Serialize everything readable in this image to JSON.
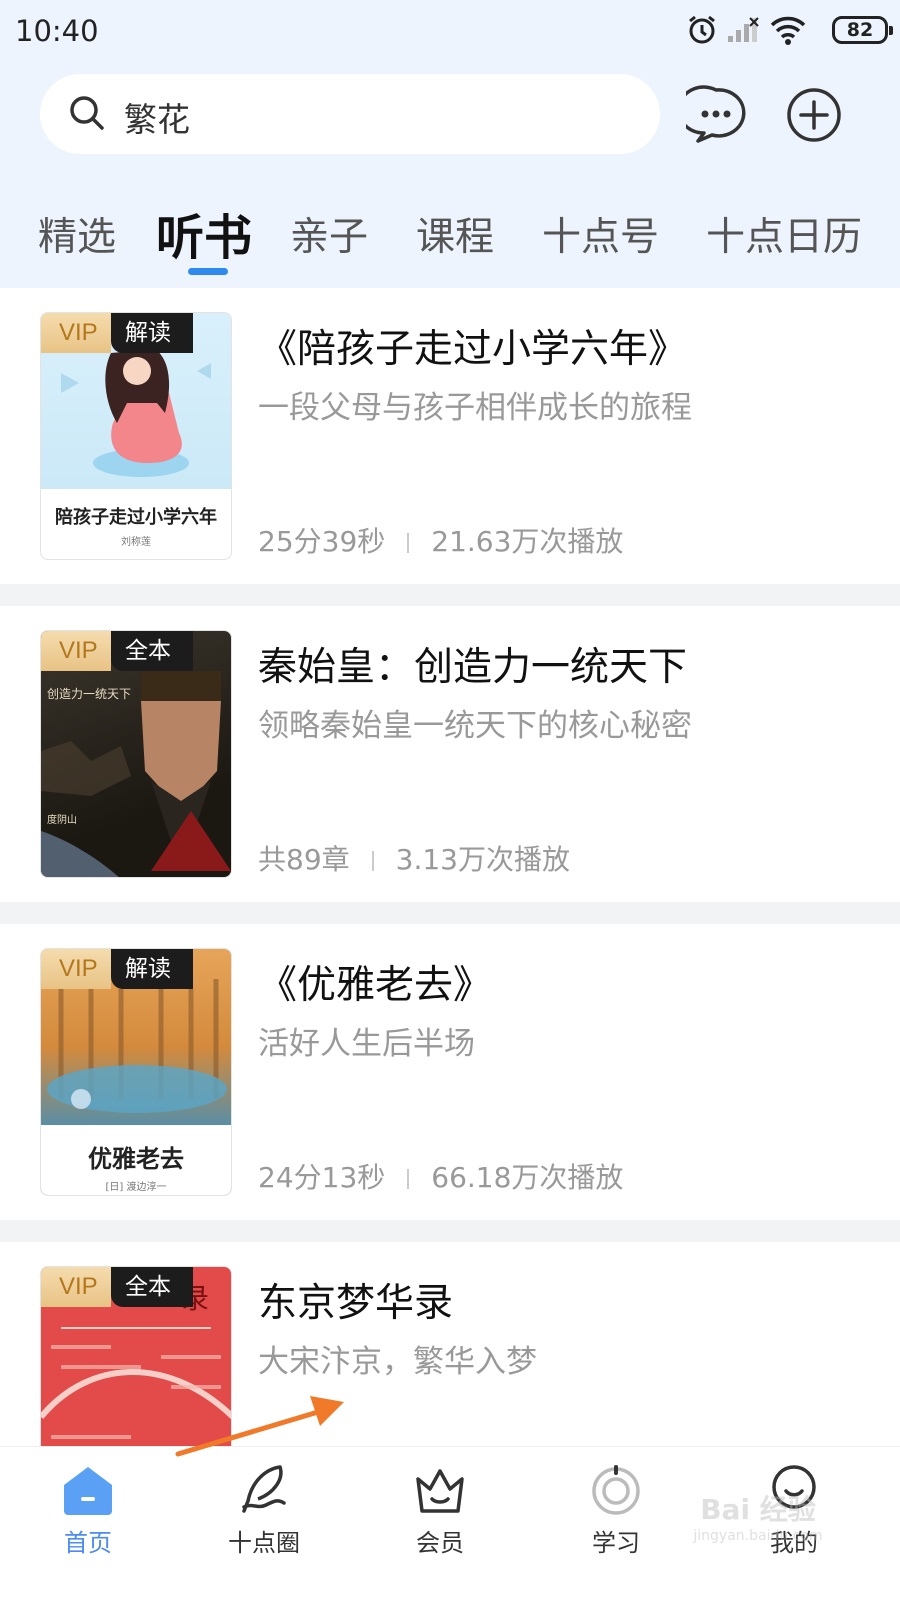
{
  "status_bar": {
    "time": "10:40",
    "battery": "82"
  },
  "search": {
    "query": "繁花"
  },
  "nav_tabs": [
    {
      "label": "精选",
      "active": false
    },
    {
      "label": "听书",
      "active": true
    },
    {
      "label": "亲子",
      "active": false
    },
    {
      "label": "课程",
      "active": false
    },
    {
      "label": "十点号",
      "active": false
    },
    {
      "label": "十点日历",
      "active": false
    }
  ],
  "books": [
    {
      "badge_vip": "VIP",
      "badge_type": "解读",
      "cover_title": "陪孩子走过小学六年",
      "cover_author": "刘称莲",
      "title": "《陪孩子走过小学六年》",
      "desc": "一段父母与孩子相伴成长的旅程",
      "duration": "25分39秒",
      "plays": "21.63万次播放"
    },
    {
      "badge_vip": "VIP",
      "badge_type": "全本",
      "cover_title": "创造力一统天下",
      "cover_author": "度阴山",
      "title": "秦始皇：创造力一统天下",
      "desc": "领略秦始皇一统天下的核心秘密",
      "duration": "共89章",
      "plays": "3.13万次播放"
    },
    {
      "badge_vip": "VIP",
      "badge_type": "解读",
      "cover_title": "优雅老去",
      "cover_author": "[日] 渡边淳一",
      "title": "《优雅老去》",
      "desc": "活好人生后半场",
      "duration": "24分13秒",
      "plays": "66.18万次播放"
    },
    {
      "badge_vip": "VIP",
      "badge_type": "全本",
      "cover_title": "录",
      "cover_author": "",
      "title": "东京梦华录",
      "desc": "大宋汴京，繁华入梦",
      "duration": "",
      "plays": ""
    }
  ],
  "tab_bar": [
    {
      "label": "首页",
      "icon": "home-icon",
      "active": true
    },
    {
      "label": "十点圈",
      "icon": "feather-icon",
      "active": false
    },
    {
      "label": "会员",
      "icon": "crown-icon",
      "active": false
    },
    {
      "label": "学习",
      "icon": "study-icon",
      "active": false
    },
    {
      "label": "我的",
      "icon": "profile-icon",
      "active": false
    }
  ],
  "watermark": {
    "brand": "Bai 经验",
    "url": "jingyan.baidu.com"
  },
  "colors": {
    "accent": "#4a8cf2",
    "header_bg": "#edf4fd",
    "vip_gold": "#e8c385",
    "annotation_arrow": "#f07a2a"
  }
}
